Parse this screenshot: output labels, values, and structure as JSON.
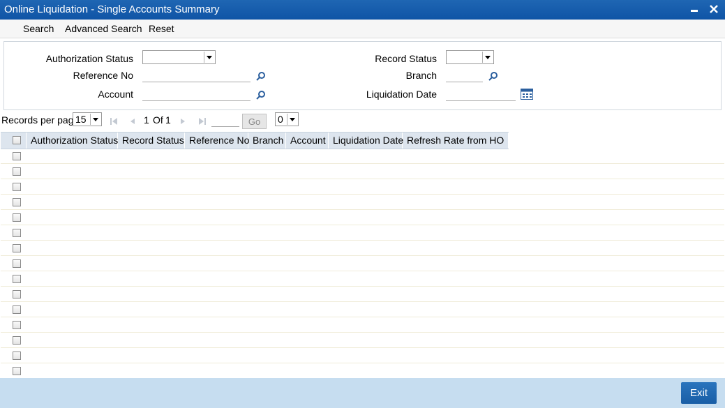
{
  "window": {
    "title": "Online Liquidation - Single Accounts Summary"
  },
  "menu": {
    "search": "Search",
    "advanced_search": "Advanced Search",
    "reset": "Reset"
  },
  "filters": {
    "authorization_status_label": "Authorization Status",
    "authorization_status_value": "",
    "reference_no_label": "Reference No",
    "reference_no_value": "",
    "account_label": "Account",
    "account_value": "",
    "record_status_label": "Record Status",
    "record_status_value": "",
    "branch_label": "Branch",
    "branch_value": "",
    "liquidation_date_label": "Liquidation Date",
    "liquidation_date_value": ""
  },
  "pager": {
    "records_per_page_label": "Records per page",
    "records_per_page_value": "15",
    "current_page": "1",
    "of_label": "Of",
    "total_pages": "1",
    "go_label": "Go",
    "extra_select_value": "0"
  },
  "grid": {
    "columns": [
      "Authorization Status",
      "Record Status",
      "Reference No",
      "Branch",
      "Account",
      "Liquidation Date",
      "Refresh Rate from HO"
    ],
    "row_count": 15
  },
  "footer": {
    "exit_label": "Exit"
  },
  "colors": {
    "titlebar": "#1560ad",
    "header_row": "#dde5ee",
    "footer": "#c6ddf0",
    "exit_button": "#1f68b0"
  }
}
